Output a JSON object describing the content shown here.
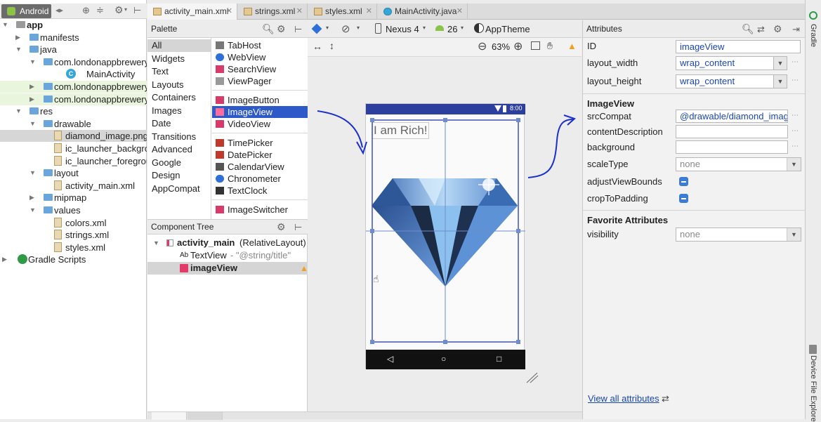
{
  "project_panel": {
    "view_label": "Android",
    "tree": [
      {
        "label": "app",
        "kind": "module",
        "bold": true
      },
      {
        "label": "manifests",
        "kind": "folder"
      },
      {
        "label": "java",
        "kind": "folder"
      },
      {
        "label": "com.londonappbrewery",
        "kind": "package"
      },
      {
        "label": "MainActivity",
        "kind": "class"
      },
      {
        "label": "com.londonappbrewery",
        "kind": "package"
      },
      {
        "label": "com.londonappbrewery",
        "kind": "package"
      },
      {
        "label": "res",
        "kind": "folder"
      },
      {
        "label": "drawable",
        "kind": "folder"
      },
      {
        "label": "diamond_image.png",
        "kind": "file",
        "selected": true
      },
      {
        "label": "ic_launcher_backgro",
        "kind": "file"
      },
      {
        "label": "ic_launcher_foregrou",
        "kind": "file"
      },
      {
        "label": "layout",
        "kind": "folder"
      },
      {
        "label": "activity_main.xml",
        "kind": "file"
      },
      {
        "label": "mipmap",
        "kind": "folder"
      },
      {
        "label": "values",
        "kind": "folder"
      },
      {
        "label": "colors.xml",
        "kind": "file"
      },
      {
        "label": "strings.xml",
        "kind": "file"
      },
      {
        "label": "styles.xml",
        "kind": "file"
      },
      {
        "label": "Gradle Scripts",
        "kind": "gradle"
      }
    ]
  },
  "editor_tabs": [
    {
      "label": "activity_main.xml",
      "active": true
    },
    {
      "label": "strings.xml"
    },
    {
      "label": "styles.xml"
    },
    {
      "label": "MainActivity.java"
    }
  ],
  "palette": {
    "title": "Palette",
    "categories": [
      "All",
      "Widgets",
      "Text",
      "Layouts",
      "Containers",
      "Images",
      "Date",
      "Transitions",
      "Advanced",
      "Google",
      "Design",
      "AppCompat"
    ],
    "widgets": [
      "TabHost",
      "WebView",
      "SearchView",
      "ViewPager",
      "ImageButton",
      "ImageView",
      "VideoView",
      "TimePicker",
      "DatePicker",
      "CalendarView",
      "Chronometer",
      "TextClock",
      "ImageSwitcher"
    ]
  },
  "component_tree": {
    "title": "Component Tree",
    "root": "activity_main",
    "root_suffix": "(RelativeLayout)",
    "textview_label": "TextView",
    "textview_value": "- \"@string/title\"",
    "imageview_label": "imageView",
    "ab": "Ab"
  },
  "design_toolbar": {
    "device": "Nexus 4",
    "api": "26",
    "theme": "AppTheme",
    "zoom": "63%"
  },
  "phone": {
    "time": "8:00",
    "text": "I am Rich!"
  },
  "attributes": {
    "title": "Attributes",
    "id_label": "ID",
    "id_value": "imageView",
    "layout_width_label": "layout_width",
    "layout_width_value": "wrap_content",
    "layout_height_label": "layout_height",
    "layout_height_value": "wrap_content",
    "section_imageview": "ImageView",
    "srccompat_label": "srcCompat",
    "srccompat_value": "@drawable/diamond_imag",
    "contentdesc_label": "contentDescription",
    "background_label": "background",
    "scaletype_label": "scaleType",
    "scaletype_value": "none",
    "adjust_label": "adjustViewBounds",
    "crop_label": "cropToPadding",
    "section_favorite": "Favorite Attributes",
    "visibility_label": "visibility",
    "visibility_value": "none",
    "view_all": "View all attributes"
  },
  "side_strip": {
    "gradle": "Gradle",
    "device_file": "Device File Explore"
  },
  "colors": {
    "selection": "#2e59c9",
    "link": "#1a46b0",
    "annotation": "#1a2fd0"
  }
}
